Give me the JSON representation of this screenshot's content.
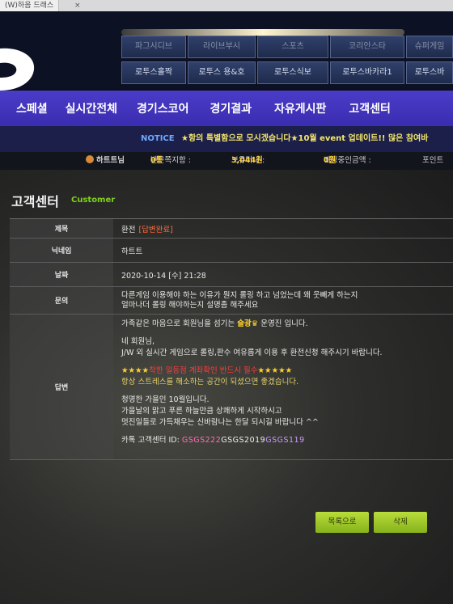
{
  "browser": {
    "tab_title": "(W)하음 드래스",
    "tab_close": "×"
  },
  "sub_tabs": {
    "row1": [
      "파그시디브",
      "라이브부시",
      "스포츠",
      "코리안스타",
      "슈퍼게임"
    ],
    "row2": [
      "로투스홀짝",
      "로투스 용&호",
      "로투스식보",
      "로투스바카라1",
      "로투스바"
    ]
  },
  "nav": {
    "items": [
      "스페셜",
      "실시간전체",
      "경기스코어",
      "경기결과",
      "자유게시판",
      "고객센터"
    ]
  },
  "notice": {
    "label": "NOTICE",
    "text": "★항의 특별함으로 모시겠습니다★10월 event 업데이트!! 많은 참여바"
  },
  "userbar": {
    "username": "하트트님",
    "received_label": "받은쪽지함 :",
    "received_value": "0통",
    "money_label": "보유머니 :",
    "money_value": "3,044원",
    "bet_label": "베팅중인금액 :",
    "bet_value": "0원",
    "point_label": "포인트"
  },
  "page": {
    "title": "고객센터",
    "subtitle": "Customer"
  },
  "post": {
    "labels": {
      "title": "제목",
      "nickname": "닉네임",
      "date": "날짜",
      "question": "문의",
      "answer": "답변"
    },
    "title": "환전",
    "status": "[답변완료]",
    "nickname": "하트트",
    "date": "2020-10-14 [수] 21:28",
    "question_lines": [
      "다른게임 이용해야 하는 이유가 뭔지 롤링 하고 넘었는데 왜 웃빼게 하는지",
      "얼마나더 롤링 해야하는지 설명좀 해주세요"
    ],
    "answer": {
      "greet_pre": "가족같은 마음으로 회원님을 섬기는 ",
      "greet_brand": "슬광♛",
      "greet_post": " 운영진 입니다.",
      "line2": "네 회원님,",
      "line3": "J/W 외 실시간 게임으로 롤링,판수 여유롭게 이용 후 환전신청 해주시기 바랍니다.",
      "stars_left": "★★★★",
      "warning": "착한 일등점 계좌확인 반드시 필수",
      "stars_right": "★★★★★",
      "line5": "항상 스트레스를 해소하는 공간이 되셨으면 좋겠습니다.",
      "line6": "청명한 가을인 10월입니다.",
      "line7": "가을날의 맑고 푸른 하늘만큼 상쾌하게 시작하시고",
      "line8": "멋진일들로 가득채우는 신바람나는 한달 되시길 바랍니다 ^^",
      "kakao_label": "카톡 고객센터 ID:",
      "kakao_id1": "GSGS222",
      "kakao_id2": "GSGS2019",
      "kakao_id3": "GSGS119"
    }
  },
  "buttons": {
    "list": "목록으로",
    "delete": "삭제"
  }
}
